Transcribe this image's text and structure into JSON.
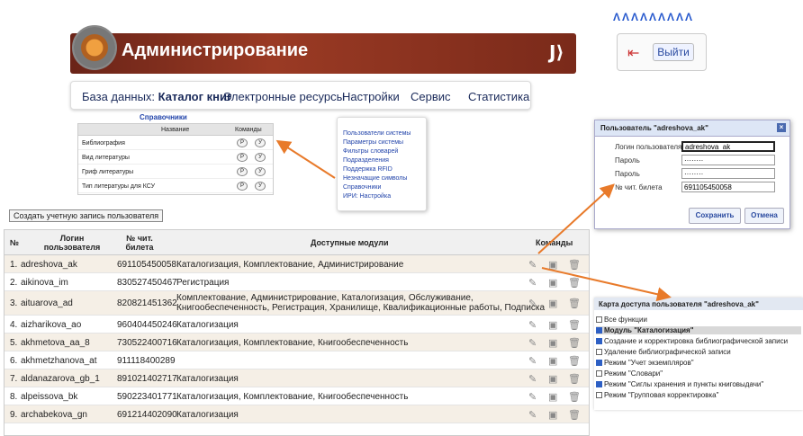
{
  "top_decor": "ΛΛΛΛΛΛΛΛΛ",
  "header": {
    "title": "Администрирование",
    "logo_glyph": "Ј⟩",
    "exit_label": "Выйти"
  },
  "nav": {
    "db_prefix": "База данных:",
    "db_name": "Каталог книг",
    "items": [
      "Электронные ресурсы",
      "Настройки",
      "Сервис",
      "Статистика"
    ]
  },
  "handbooks": {
    "title": "Справочники",
    "col_name": "Название",
    "col_cmd": "Команды",
    "p_label": "P",
    "y_label": "У",
    "rows": [
      "Библиография",
      "Вид литературы",
      "Гриф литературы",
      "Тип литературы для КСУ"
    ]
  },
  "settings_menu": [
    "Пользователи системы",
    "Параметры системы",
    "Фильтры словарей",
    "Подразделения",
    "Поддержка RFID",
    "Незначащие символы",
    "Справочники",
    "ИРИ: Настройка"
  ],
  "create_button": "Создать учетную запись пользователя",
  "table": {
    "headers": {
      "num": "№",
      "login": "Логин пользователя",
      "ticket": "№ чит. билета",
      "modules": "Доступные модули",
      "commands": "Команды"
    },
    "rows": [
      {
        "n": "1.",
        "login": "adreshova_ak",
        "ticket": "691105450058",
        "modules": "Каталогизация, Комплектование, Администрирование",
        "modules2": ""
      },
      {
        "n": "2.",
        "login": "aikinova_im",
        "ticket": "830527450467",
        "modules": "Регистрация",
        "modules2": ""
      },
      {
        "n": "3.",
        "login": "aituarova_ad",
        "ticket": "820821451362",
        "modules": "Комплектование, Администрирование, Каталогизация, Обслуживание,",
        "modules2": "Книгообеспеченность, Регистрация, Хранилище, Квалификационные работы, Подписка"
      },
      {
        "n": "4.",
        "login": "aizharikova_ao",
        "ticket": "960404450246",
        "modules": "Каталогизация",
        "modules2": ""
      },
      {
        "n": "5.",
        "login": "akhmetova_aa_8",
        "ticket": "730522400716",
        "modules": "Каталогизация, Комплектование, Книгообеспеченность",
        "modules2": ""
      },
      {
        "n": "6.",
        "login": "akhmetzhanova_at",
        "ticket": "911118400289",
        "modules": "",
        "modules2": ""
      },
      {
        "n": "7.",
        "login": "aldanazarova_gb_1",
        "ticket": "891021402717",
        "modules": "Каталогизация",
        "modules2": ""
      },
      {
        "n": "8.",
        "login": "alpeissova_bk",
        "ticket": "590223401771",
        "modules": "Каталогизация, Комплектование, Книгообеспеченность",
        "modules2": ""
      },
      {
        "n": "9.",
        "login": "archabekova_gn",
        "ticket": "691214402090",
        "modules": "Каталогизация",
        "modules2": ""
      }
    ]
  },
  "user_dialog": {
    "title": "Пользователь \"adreshova_ak\"",
    "login_label": "Логин пользователя",
    "login_value": "adreshova_ak",
    "password_label": "Пароль",
    "password_value": "········",
    "password2_label": "Пароль",
    "password2_value": "········",
    "ticket_label": "№ чит. билета",
    "ticket_value": "691105450058",
    "save": "Сохранить",
    "cancel": "Отмена"
  },
  "access_card": {
    "title": "Карта доступа пользователя \"adreshova_ak\"",
    "items": [
      {
        "label": "Все функции",
        "checked": false
      },
      {
        "label": "Модуль \"Каталогизация\"",
        "checked": true
      },
      {
        "label": "Создание и корректировка библиографической записи",
        "checked": true
      },
      {
        "label": "Удаление библиографической записи",
        "checked": false
      },
      {
        "label": "Режим \"Учет экземпляров\"",
        "checked": true
      },
      {
        "label": "Режим \"Словари\"",
        "checked": false
      },
      {
        "label": "Режим \"Сиглы хранения и пункты книговыдачи\"",
        "checked": true
      },
      {
        "label": "Режим \"Групповая корректировка\"",
        "checked": false
      }
    ]
  },
  "colors": {
    "accent_arrow": "#e87a2a",
    "banner": "#8a3020",
    "checkbox_on": "#2d5fc4"
  }
}
